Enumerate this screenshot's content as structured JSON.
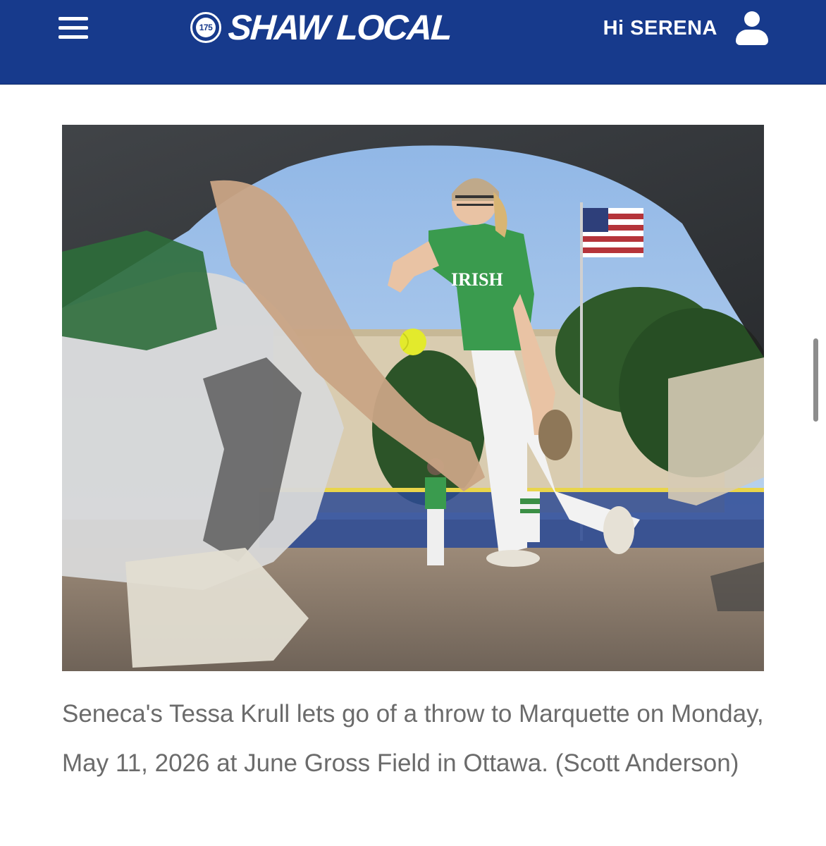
{
  "header": {
    "menu_icon": "hamburger-menu-icon",
    "logo_badge": "175",
    "logo_text": "SHAW LOCAL",
    "greeting": "Hi SERENA",
    "user_icon": "user-profile-icon",
    "background_color": "#173a8c"
  },
  "article": {
    "photo_alt": "Seneca softball pitcher in a green IRISH jersey throwing a yellow softball",
    "photo_jersey_text": "IRISH",
    "caption": "Seneca's Tessa Krull lets go of a throw to Marquette on Monday, May 11, 2026 at June Gross Field in Ottawa. (Scott Anderson)"
  }
}
